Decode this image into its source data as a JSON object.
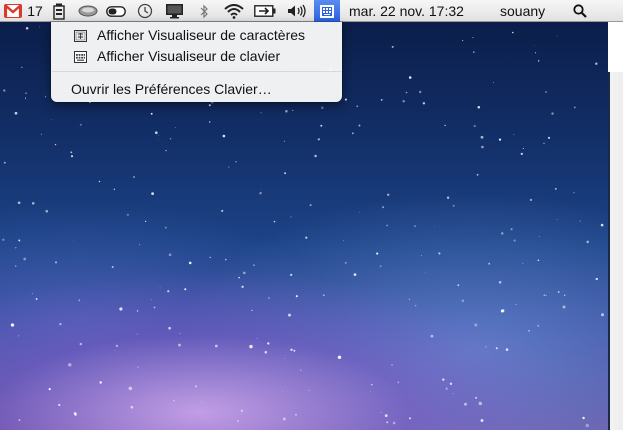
{
  "menubar": {
    "gmail_count": "17",
    "clock": "mar. 22 nov.  17:32",
    "user": "souany",
    "icons": [
      "gmail-icon",
      "battery-tray-icon",
      "disk-eye-icon",
      "toggle-icon",
      "time-machine-icon",
      "display-icon",
      "bluetooth-icon",
      "wifi-icon",
      "battery-icon",
      "volume-icon",
      "keyboard-viewer-icon",
      "spotlight-icon"
    ]
  },
  "menu": {
    "items": [
      {
        "label": "Afficher Visualiseur de caractères",
        "icon": "character-viewer-icon"
      },
      {
        "label": "Afficher Visualiseur de clavier",
        "icon": "keyboard-viewer-icon"
      },
      {
        "label": "Ouvrir les Préférences Clavier…"
      }
    ]
  },
  "colors": {
    "menu_highlight": "#2b60e0",
    "gmail_red": "#d93a2b"
  }
}
